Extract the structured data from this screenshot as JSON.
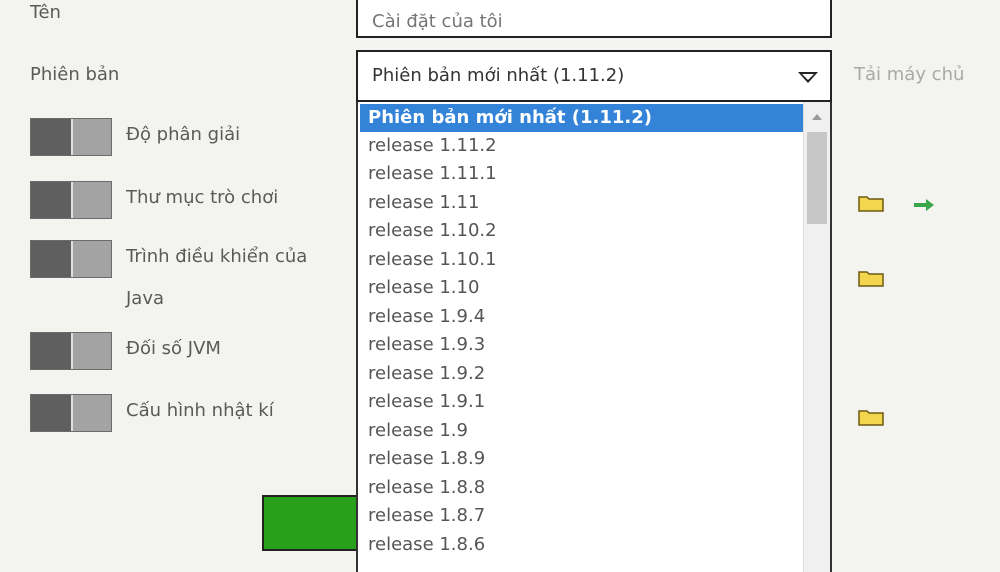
{
  "form": {
    "name_label": "Tên",
    "name_placeholder": "Cài đặt của tôi",
    "version_label": "Phiên bản",
    "selected_version": "Phiên bản mới nhất (1.11.2)",
    "server_link": "Tải máy chủ"
  },
  "toggles": [
    {
      "label": "Độ phân giải"
    },
    {
      "label": "Thư mục trò chơi"
    },
    {
      "label": "Trình điều khiển của",
      "label2": "Java"
    },
    {
      "label": "Đối số JVM"
    },
    {
      "label": "Cấu hình nhật kí"
    }
  ],
  "version_options": [
    "Phiên bản mới nhất (1.11.2)",
    "release 1.11.2",
    "release 1.11.1",
    "release 1.11",
    "release 1.10.2",
    "release 1.10.1",
    "release 1.10",
    "release 1.9.4",
    "release 1.9.3",
    "release 1.9.2",
    "release 1.9.1",
    "release 1.9",
    "release 1.8.9",
    "release 1.8.8",
    "release 1.8.7",
    "release 1.8.6"
  ],
  "colors": {
    "selected_option": "#3383d8",
    "save_button": "#28a01a",
    "folder": "#f3d64d",
    "arrow": "#3aa64a"
  },
  "icons": {
    "folder": "folder-icon",
    "arrow": "arrow-right-icon",
    "dropdown": "chevron-down-icon"
  }
}
